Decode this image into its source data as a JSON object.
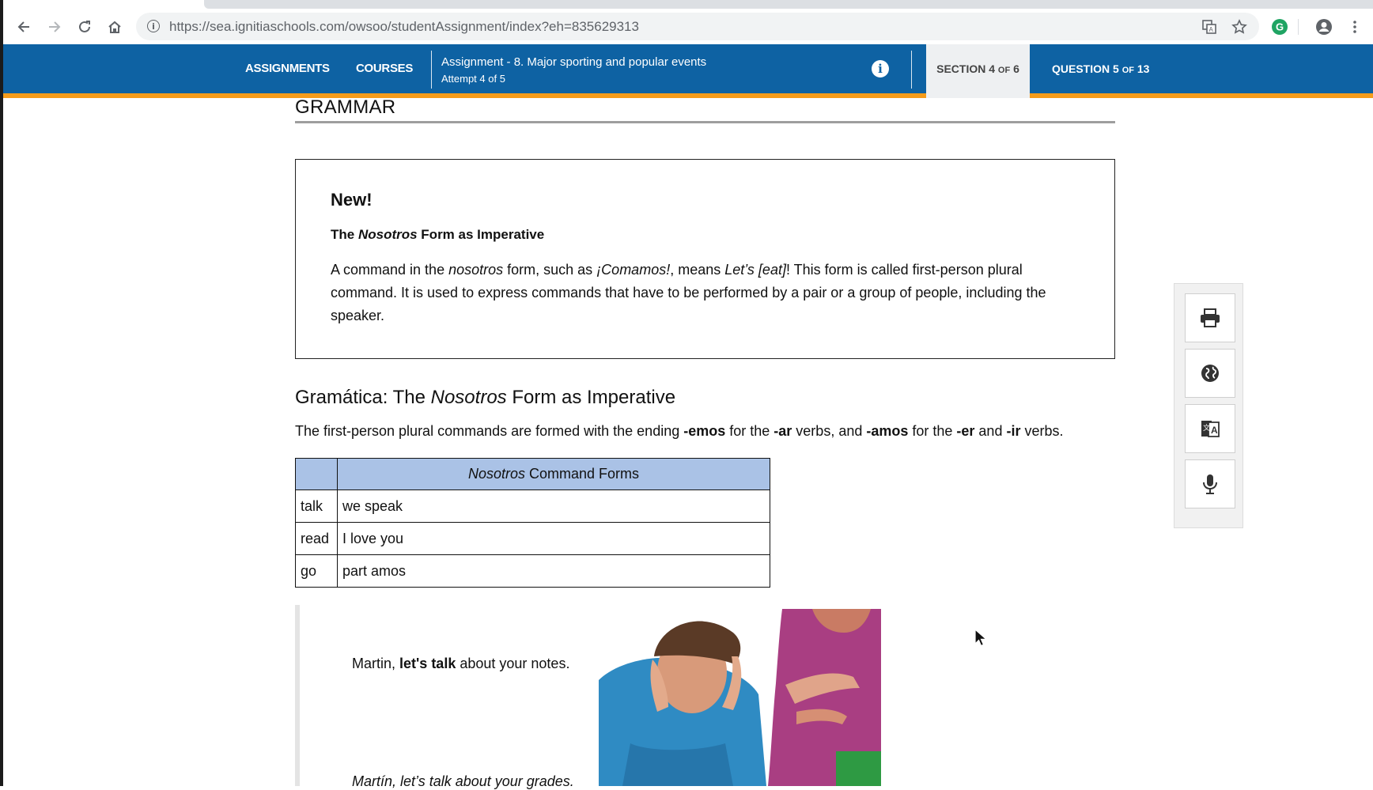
{
  "browser": {
    "url": "https://sea.ignitiaschools.com/owsoo/studentAssignment/index?eh=835629313",
    "back_icon": "arrow-left-icon",
    "forward_icon": "arrow-right-icon",
    "reload_icon": "reload-icon",
    "home_icon": "home-icon",
    "extension_badge_color": "#1fa463"
  },
  "header": {
    "nav": {
      "assignments": "Assignments",
      "courses": "Courses"
    },
    "assignment_title": "Assignment - 8. Major sporting and popular events",
    "attempt": "Attempt 4 of 5",
    "section": {
      "label": "Section",
      "current": "4",
      "of_text": "of",
      "total": "6"
    },
    "question": {
      "label": "Question",
      "current": "5",
      "of_text": "of",
      "total": "13"
    },
    "colors": {
      "bar": "#0e62a3",
      "accent": "#f59c1b",
      "section_tab_bg": "#eef0f2"
    }
  },
  "content": {
    "grammar_heading": "GRAMMAR",
    "new_box": {
      "title": "New!",
      "subtitle_pre": "The ",
      "subtitle_em": "Nosotros",
      "subtitle_post": " Form as Imperative",
      "para": {
        "p1": "A command in the ",
        "em1": "nosotros",
        "p2": " form, such as ",
        "em2": "¡Comamos!",
        "p3": ", means ",
        "em3": "Let’s [eat]",
        "p4": "! This form is called first-person plural command. It is used to express commands that have to be performed by a pair or a group of people, including the speaker."
      }
    },
    "gramatica": {
      "heading_pre": "Gramática: The ",
      "heading_em": "Nosotros",
      "heading_post": " Form as Imperative",
      "para": {
        "p1": "The first-person plural commands are formed with the ending ",
        "b1": "-emos",
        "p2": " for the ",
        "b2": "-ar",
        "p3": " verbs, and ",
        "b3": "-amos",
        "p4": " for the ",
        "b4": "-er",
        "p5": " and ",
        "b5": "-ir",
        "p6": " verbs."
      }
    },
    "table": {
      "header_em": "Nosotros",
      "header_rest": " Command Forms",
      "rows": [
        {
          "verb": "talk",
          "form_a": "we",
          "form_b": " speak"
        },
        {
          "verb": "read",
          "form_a": "I",
          "form_b": " love you"
        },
        {
          "verb": "go",
          "form_a": "part",
          "form_b": " amos"
        }
      ]
    },
    "dialogue": {
      "line1_pre": "Martin, ",
      "line1_b": "let's talk",
      "line1_post": " about your notes.",
      "line2": "Martín, let’s talk about your grades."
    }
  },
  "tools": {
    "print_icon": "print-icon",
    "globe_icon": "globe-icon",
    "translate_icon": "translate-icon",
    "mic_icon": "microphone-icon"
  }
}
